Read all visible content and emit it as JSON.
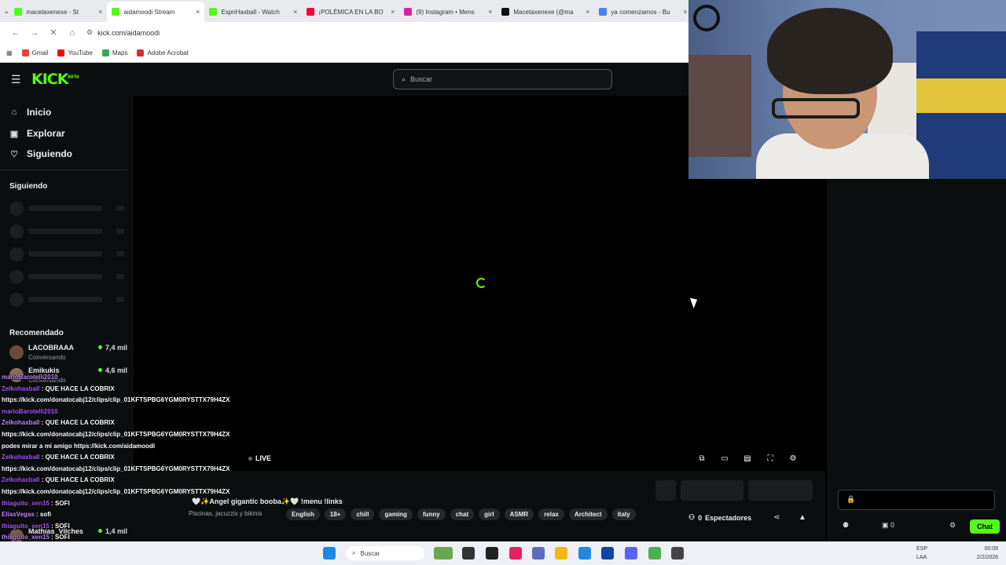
{
  "browser": {
    "tabs": [
      {
        "title": "macetaxenexe - St",
        "color": "#53fc18",
        "active": false
      },
      {
        "title": "aidamoodi Stream",
        "color": "#53fc18",
        "active": true
      },
      {
        "title": "EspnHaxball - Watch",
        "color": "#53fc18",
        "active": false
      },
      {
        "title": "¡POLÉMICA EN LA BO",
        "color": "#ff0033",
        "active": false
      },
      {
        "title": "(9) Instagram • Mens",
        "color": "#d6249f",
        "active": false
      },
      {
        "title": "Macetaxenexe (@ma",
        "color": "#111111",
        "active": false
      },
      {
        "title": "ya comenzamos - Bu",
        "color": "#4285f4",
        "active": false
      }
    ],
    "url": "kick.com/aidamoodi",
    "bookmarks": [
      {
        "label": "Gmail",
        "color": "#ea4335"
      },
      {
        "label": "YouTube",
        "color": "#ff0000"
      },
      {
        "label": "Maps",
        "color": "#34a853"
      },
      {
        "label": "Adobe Acrobat",
        "color": "#d32f2f"
      }
    ]
  },
  "kick": {
    "logo": "KICK",
    "logo_sup": "BETA",
    "search_placeholder": "Buscar",
    "nav": [
      {
        "label": "Inicio",
        "icon": "home-icon"
      },
      {
        "label": "Explorar",
        "icon": "compass-icon"
      },
      {
        "label": "Siguiendo",
        "icon": "heart-icon"
      }
    ],
    "following_heading": "Siguiendo",
    "recommended_heading": "Recomendado",
    "recommended": [
      {
        "name": "LACOBRAAA",
        "category": "Conversando",
        "viewers": "7,4 mil"
      },
      {
        "name": "Emikukis",
        "category": "Conversando",
        "viewers": "4,6 mil"
      }
    ],
    "recommended_last": {
      "name": "Mathias_Vilches",
      "viewers": "1,4 mil"
    },
    "player": {
      "live": "LIVE"
    },
    "stream_title": "🤍✨Angel gigantic booba✨🤍 !menu !links",
    "stream_category": "Piscinas, jacuzzis y bikinis",
    "tags": [
      "English",
      "18+",
      "chill",
      "gaming",
      "funny",
      "chat",
      "girl",
      "ASMR",
      "relax",
      "Architect",
      "italy"
    ],
    "viewers_label": "Espectadores",
    "viewers_count": "0",
    "chat_button": "Chat",
    "chat_count": "0"
  },
  "overlay_chat": [
    {
      "user": "marioBarotelli2010",
      "text": ""
    },
    {
      "user": "Zelkohaxball",
      "text": "QUE HACE LA COBRIX"
    },
    {
      "user": "",
      "text": "https://kick.com/donatocabj12/clips/clip_01KFTSPBG6YGM0RYSTTX79H4ZX"
    },
    {
      "user": "marioBarotelli2010",
      "text": ""
    },
    {
      "user": "Zelkohaxball",
      "text": "QUE HACE LA COBRIX"
    },
    {
      "user": "",
      "text": "https://kick.com/donatocabj12/clips/clip_01KFTSPBG6YGM0RYSTTX79H4ZX"
    },
    {
      "user": "",
      "text": "podes mirar a mi amigo https://kick.com/aidamoodi"
    },
    {
      "user": "Zelkohaxball",
      "text": "QUE HACE LA COBRIX"
    },
    {
      "user": "",
      "text": "https://kick.com/donatocabj12/clips/clip_01KFTSPBG6YGM0RYSTTX79H4ZX"
    },
    {
      "user": "Zelkohaxball",
      "text": "QUE HACE LA COBRIX"
    },
    {
      "user": "",
      "text": "https://kick.com/donatocabj12/clips/clip_01KFTSPBG6YGM0RYSTTX79H4ZX"
    },
    {
      "user": "thiaguito_xen15",
      "text": "SOFI"
    },
    {
      "user": "EliasVegas",
      "text": "sofi"
    },
    {
      "user": "thiaguito_xen15",
      "text": "SOFI"
    },
    {
      "user": "thiaguito_xen15",
      "text": "SOFI"
    }
  ],
  "taskbar": {
    "search": "Buscar",
    "lang_top": "ESP",
    "lang_bottom": "LAA",
    "time": "00:09",
    "date": "2/2/2026"
  }
}
